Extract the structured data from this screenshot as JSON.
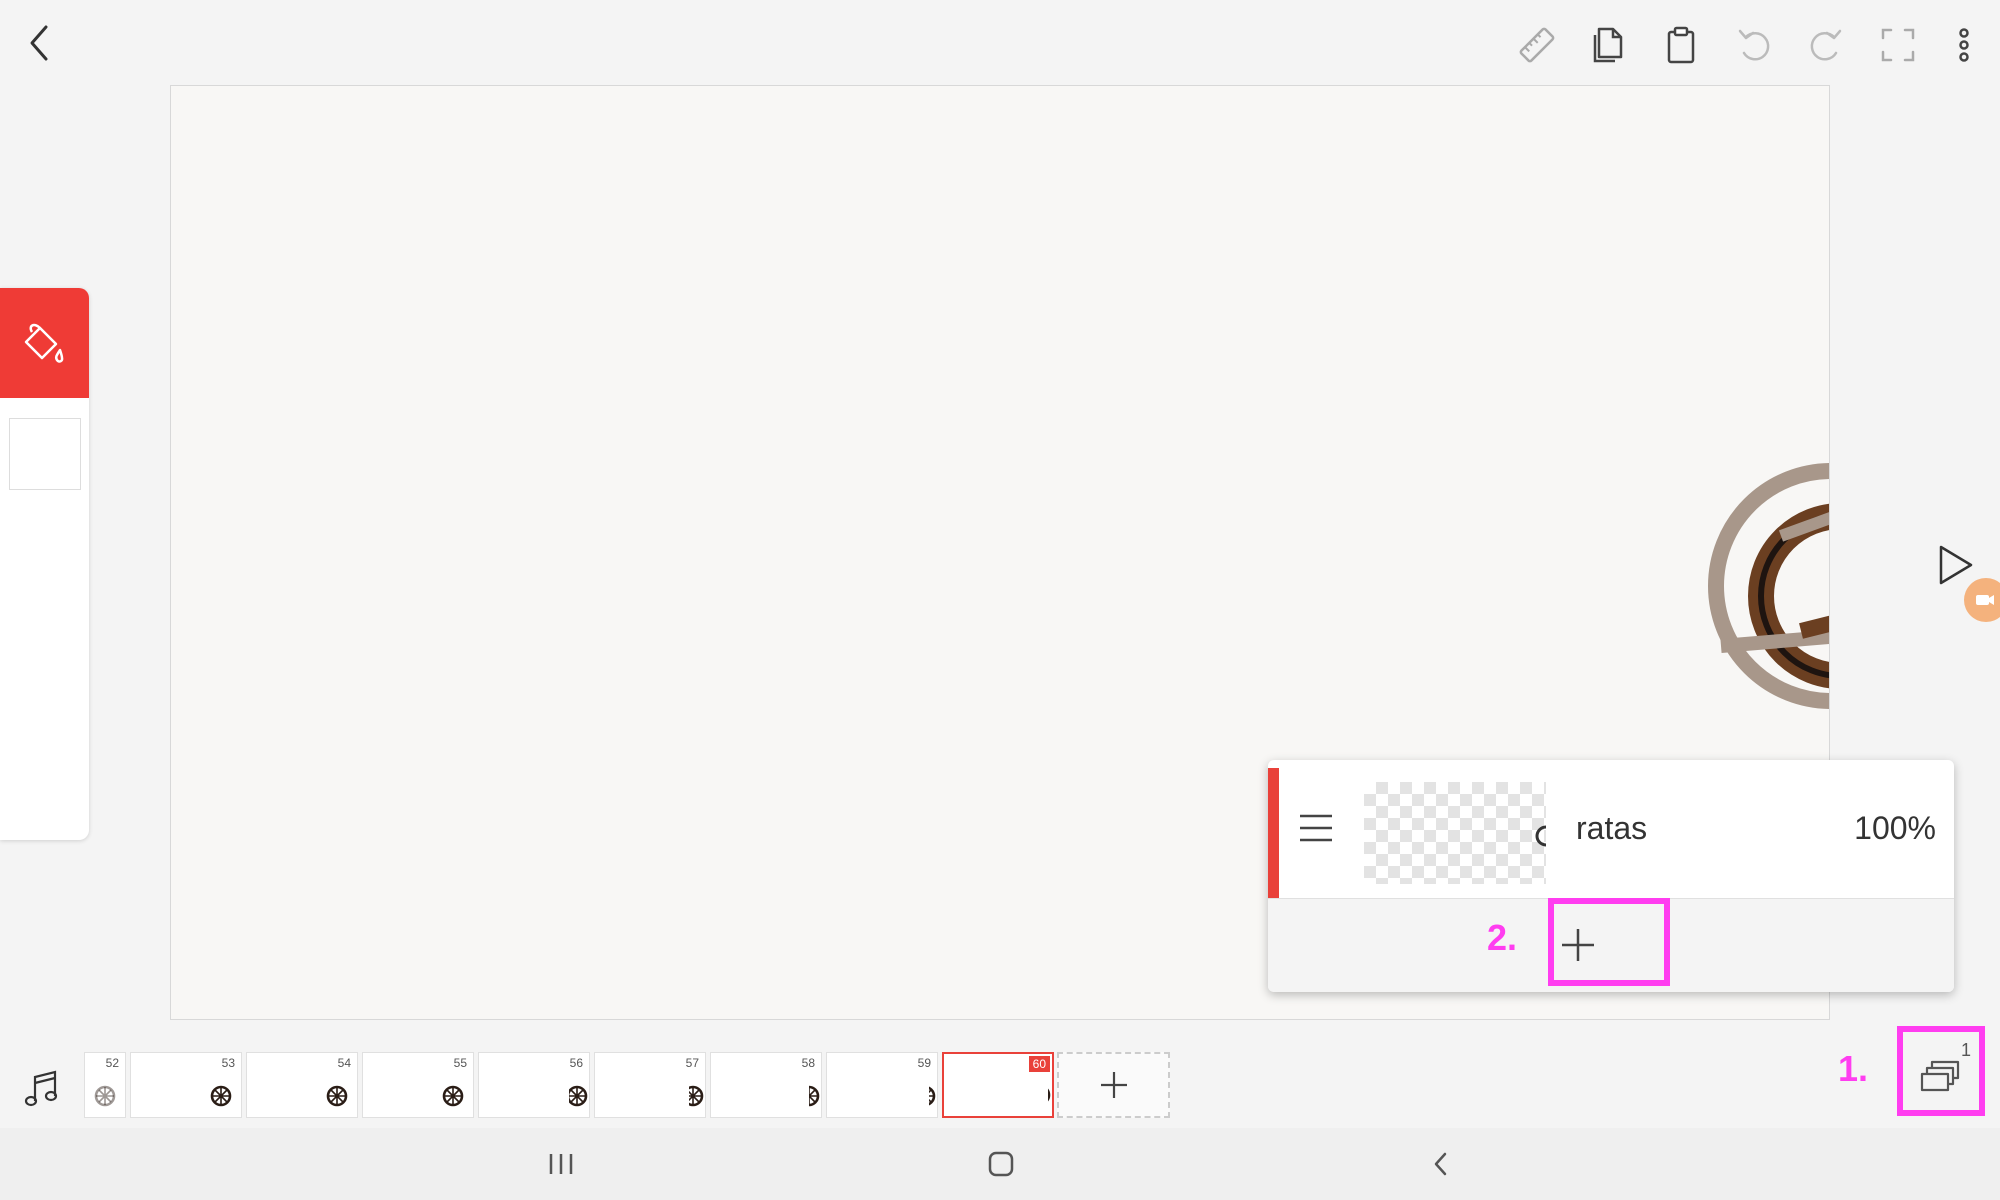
{
  "toolbar": {
    "back_icon": "chevron-left-icon",
    "icons": [
      "ruler-icon",
      "copy-icon",
      "paste-icon",
      "undo-icon",
      "redo-icon",
      "fullscreen-icon",
      "more-vert-icon"
    ]
  },
  "tools": {
    "active_tool_icon": "paint-bucket-icon",
    "active_tool_color": "#ef3b36",
    "current_color": "#ffffff"
  },
  "layer_panel": {
    "layer_name": "ratas",
    "layer_opacity": "100%",
    "add_layer_icon": "plus-icon"
  },
  "annotations": {
    "step1": "1.",
    "step2": "2.",
    "highlight_color": "#ff3df0"
  },
  "timeline": {
    "frames": [
      {
        "num": "52"
      },
      {
        "num": "53"
      },
      {
        "num": "54"
      },
      {
        "num": "55"
      },
      {
        "num": "56"
      },
      {
        "num": "57"
      },
      {
        "num": "58"
      },
      {
        "num": "59"
      },
      {
        "num": "60",
        "selected": true
      }
    ],
    "layers_count_badge": "1"
  },
  "nav": {
    "icons": [
      "recent-apps-icon",
      "home-icon",
      "nav-back-icon"
    ]
  }
}
